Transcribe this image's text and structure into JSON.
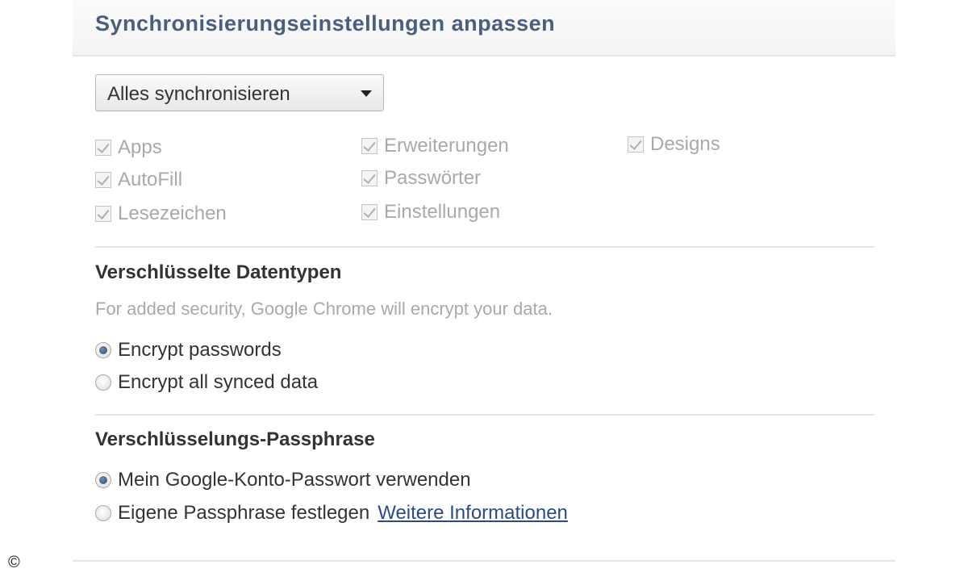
{
  "header": {
    "title": "Synchronisierungseinstellungen anpassen"
  },
  "sync_select": {
    "value": "Alles synchronisieren"
  },
  "data_types": [
    {
      "label": "Apps",
      "checked": true,
      "disabled": true
    },
    {
      "label": "AutoFill",
      "checked": true,
      "disabled": true
    },
    {
      "label": "Lesezeichen",
      "checked": true,
      "disabled": true
    },
    {
      "label": "Erweiterungen",
      "checked": true,
      "disabled": true
    },
    {
      "label": "Passwörter",
      "checked": true,
      "disabled": true
    },
    {
      "label": "Einstellungen",
      "checked": true,
      "disabled": true
    },
    {
      "label": "Designs",
      "checked": true,
      "disabled": true
    }
  ],
  "encrypted_section": {
    "title": "Verschlüsselte Datentypen",
    "description": "For added security, Google Chrome will encrypt your data.",
    "options": [
      {
        "label": "Encrypt passwords",
        "selected": true
      },
      {
        "label": "Encrypt all synced data",
        "selected": false
      }
    ]
  },
  "passphrase_section": {
    "title": "Verschlüsselungs-Passphrase",
    "options": [
      {
        "label": "Mein Google-Konto-Passwort verwenden",
        "selected": true
      },
      {
        "label": "Eigene Passphrase festlegen",
        "selected": false
      }
    ],
    "link_label": "Weitere Informationen"
  },
  "copyright_symbol": "©"
}
